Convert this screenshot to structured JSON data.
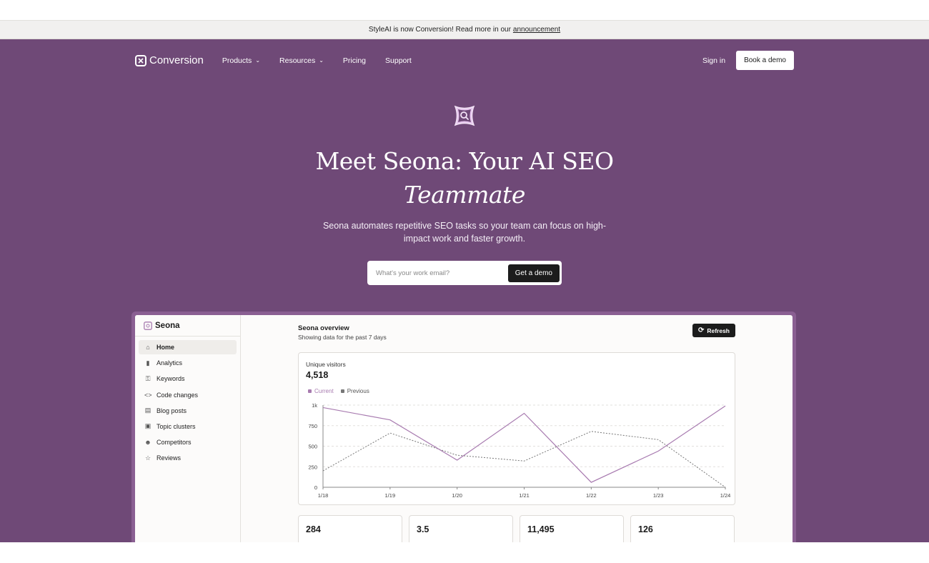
{
  "announcement": {
    "text": "StyleAI is now Conversion! Read more in our",
    "link": "announcement"
  },
  "nav": {
    "brand": "Conversion",
    "links": [
      {
        "label": "Products",
        "dropdown": true
      },
      {
        "label": "Resources",
        "dropdown": true
      },
      {
        "label": "Pricing",
        "dropdown": false
      },
      {
        "label": "Support",
        "dropdown": false
      }
    ],
    "sign_in": "Sign in",
    "book_demo": "Book a demo"
  },
  "hero": {
    "headline_line1": "Meet Seona: Your AI SEO",
    "headline_line2": "Teammate",
    "subtext": "Seona automates repetitive SEO tasks so your team can focus on high-impact work and faster growth.",
    "email_placeholder": "What's your work email?",
    "cta": "Get a demo"
  },
  "app": {
    "name": "Seona",
    "sidebar": [
      {
        "label": "Home",
        "icon": "home-icon",
        "active": true
      },
      {
        "label": "Analytics",
        "icon": "bar-chart-icon",
        "active": false
      },
      {
        "label": "Keywords",
        "icon": "key-icon",
        "active": false
      },
      {
        "label": "Code changes",
        "icon": "code-icon",
        "active": false
      },
      {
        "label": "Blog posts",
        "icon": "document-icon",
        "active": false
      },
      {
        "label": "Topic clusters",
        "icon": "scan-icon",
        "active": false
      },
      {
        "label": "Competitors",
        "icon": "users-icon",
        "active": false
      },
      {
        "label": "Reviews",
        "icon": "star-icon",
        "active": false
      }
    ],
    "overview_title": "Seona overview",
    "overview_subtitle": "Showing data for the past 7 days",
    "refresh_label": "Refresh",
    "card": {
      "label": "Unique visitors",
      "value": "4,518"
    },
    "stats": [
      "284",
      "3.5",
      "11,495",
      "126"
    ]
  },
  "colors": {
    "hero_bg": "#6f4977",
    "current_series": "#a87bb0",
    "previous_series": "#777777"
  },
  "chart_data": {
    "type": "line",
    "x": [
      "1/18",
      "1/19",
      "1/20",
      "1/21",
      "1/22",
      "1/23",
      "1/24"
    ],
    "series": [
      {
        "name": "Current",
        "values": [
          970,
          820,
          330,
          900,
          60,
          440,
          990
        ]
      },
      {
        "name": "Previous",
        "values": [
          200,
          660,
          390,
          320,
          680,
          580,
          0
        ]
      }
    ],
    "yticks": [
      "0",
      "250",
      "500",
      "750",
      "1k"
    ],
    "ylim": [
      0,
      1000
    ],
    "grid": true,
    "legend": "top-left"
  }
}
